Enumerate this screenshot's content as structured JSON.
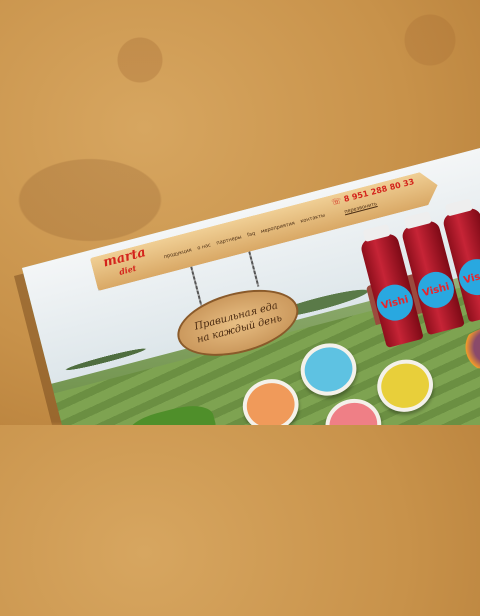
{
  "site": {
    "logo_main": "marta",
    "logo_sub": "diet",
    "nav": [
      "продукция",
      "о нас",
      "партнеры",
      "faq",
      "мероприятия",
      "контакты"
    ],
    "phone": "8 951 288 80 33",
    "phone_sub": "перезвонить"
  },
  "hero": {
    "sign_line1": "Правильная еда",
    "sign_line2": "на каждый день",
    "bottle_brand": "Vishi"
  },
  "colors": {
    "background": "#c8924a",
    "brand_red": "#d4241c",
    "label_blue": "#29a8e0"
  }
}
